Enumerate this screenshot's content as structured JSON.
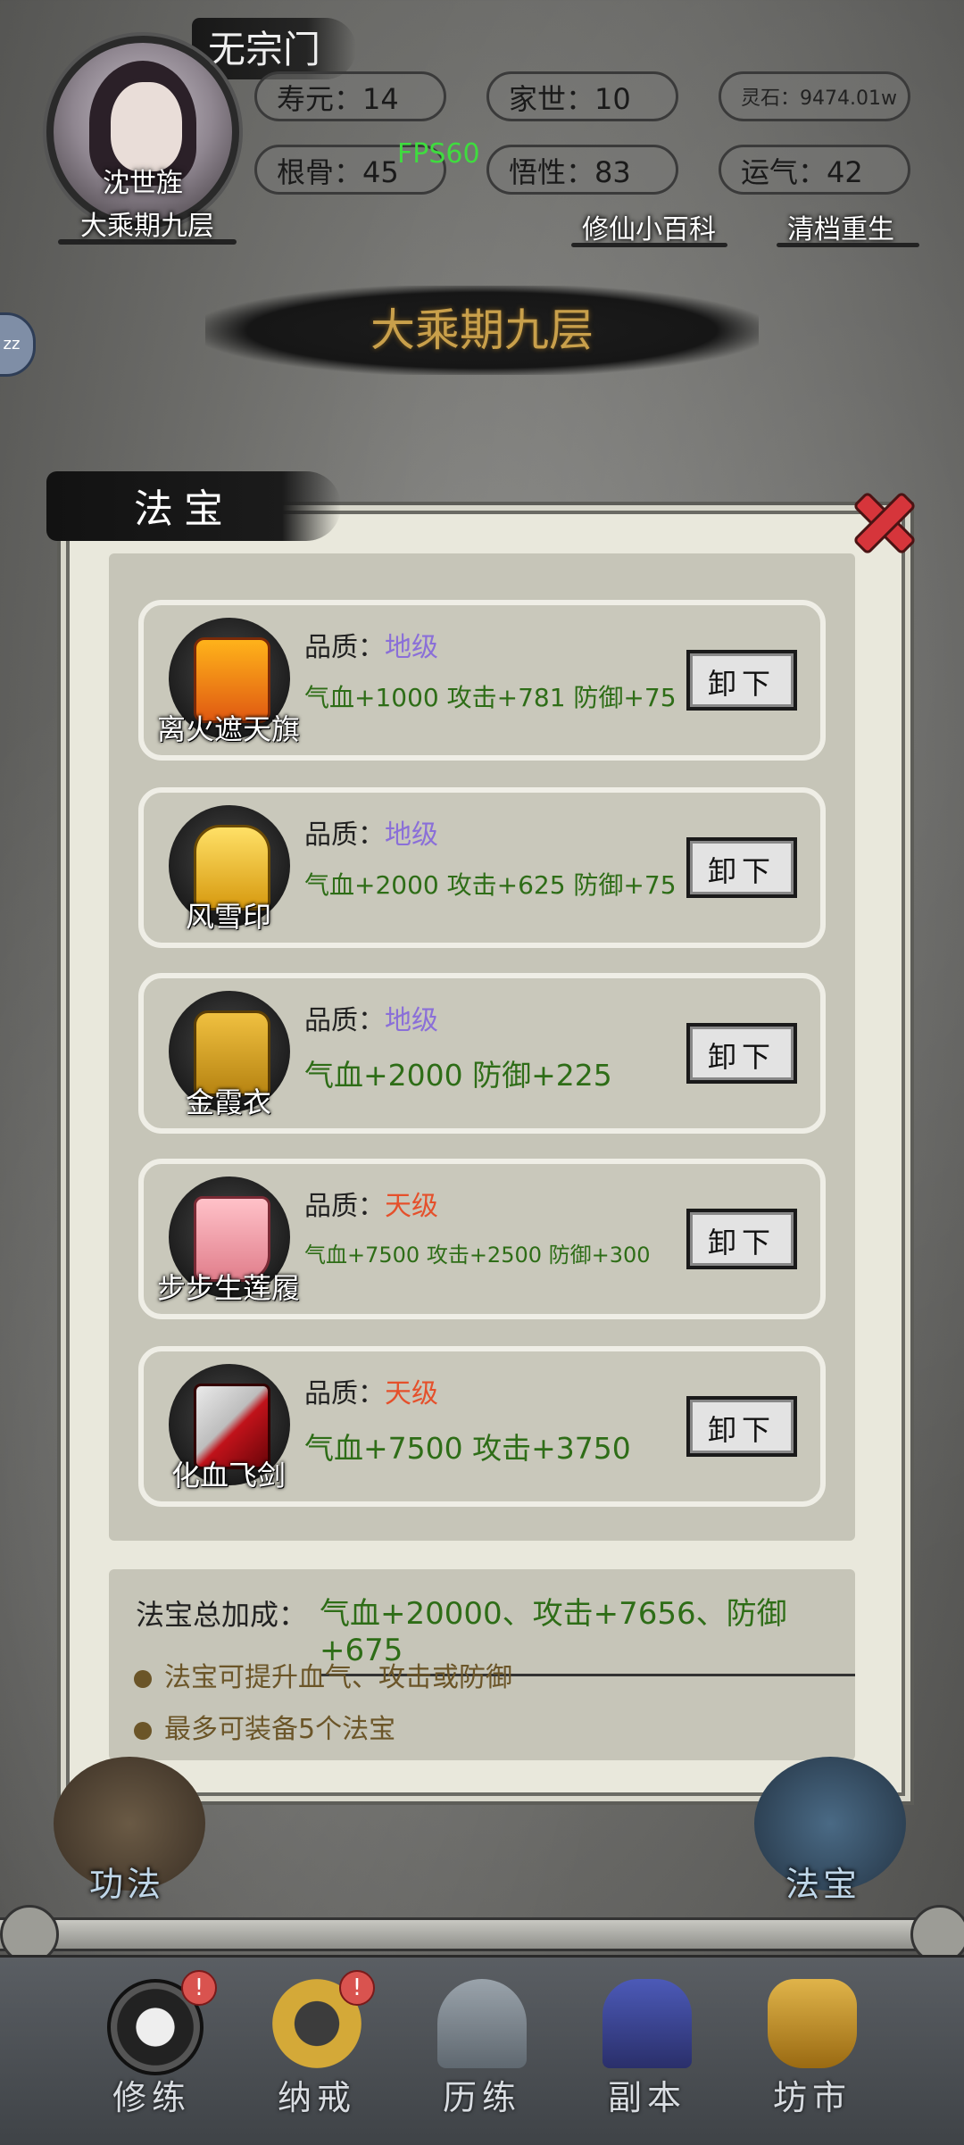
{
  "header": {
    "sect": "无宗门",
    "player_name": "沈世旌",
    "player_realm": "大乘期九层",
    "stats": {
      "lifespan": "寿元：14",
      "family": "家世：10",
      "spirit_stone": "灵石：9474.01w",
      "root": "根骨：45",
      "comprehension": "悟性：83",
      "luck": "运气：42"
    },
    "fps": "FPS60",
    "links": {
      "wiki": "修仙小百科",
      "reset": "清档重生"
    },
    "side_button": "zz",
    "realm_banner": "大乘期九层"
  },
  "modal": {
    "title": "法宝",
    "items": [
      {
        "name": "离火遮天旗",
        "quality_label": "品质：",
        "quality": "地级",
        "stats": "气血+1000 攻击+781 防御+75",
        "action": "卸下"
      },
      {
        "name": "风雪印",
        "quality_label": "品质：",
        "quality": "地级",
        "stats": "气血+2000 攻击+625 防御+75",
        "action": "卸下"
      },
      {
        "name": "金霞衣",
        "quality_label": "品质：",
        "quality": "地级",
        "stats": "气血+2000 防御+225",
        "action": "卸下"
      },
      {
        "name": "步步生莲履",
        "quality_label": "品质：",
        "quality": "天级",
        "stats": "气血+7500 攻击+2500 防御+300",
        "action": "卸下"
      },
      {
        "name": "化血飞剑",
        "quality_label": "品质：",
        "quality": "天级",
        "stats": "气血+7500 攻击+3750",
        "action": "卸下"
      }
    ],
    "bonus_label": "法宝总加成：",
    "bonus_value": "气血+20000、攻击+7656、防御+675",
    "tips": [
      "法宝可提升血气、攻击或防御",
      "最多可装备5个法宝"
    ]
  },
  "bottom": {
    "left_feature": "功法",
    "right_feature": "法宝",
    "nav": [
      {
        "label": "修练",
        "badge": "!"
      },
      {
        "label": "纳戒",
        "badge": "!"
      },
      {
        "label": "历练"
      },
      {
        "label": "副本"
      },
      {
        "label": "坊市"
      }
    ]
  },
  "colors": {
    "earth_grade": "#8a6fd8",
    "heaven_grade": "#e5502b",
    "stat_green": "#2e6d17"
  }
}
